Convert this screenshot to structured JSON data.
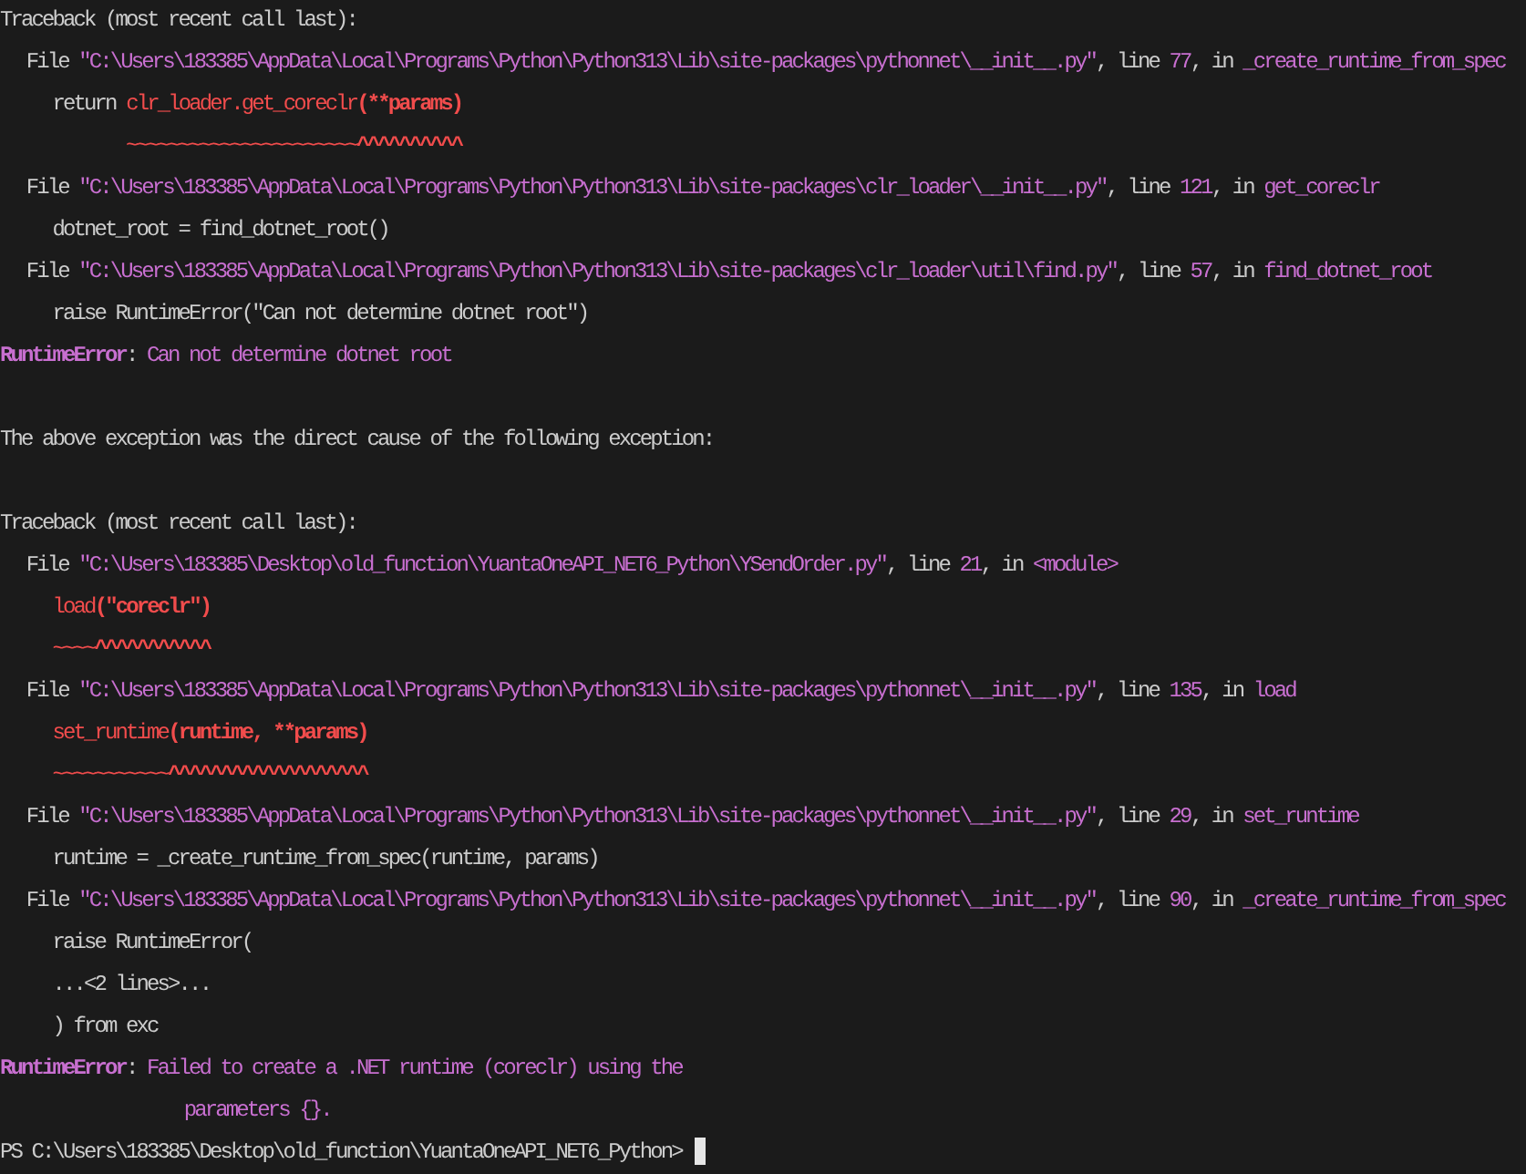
{
  "terminal": {
    "lines": [
      {
        "kind": "header",
        "segments": [
          {
            "kind": "plain",
            "text": "Traceback (most recent call last):"
          }
        ]
      },
      {
        "kind": "frame",
        "segments": [
          {
            "kind": "plain",
            "text": "File "
          },
          {
            "kind": "accent",
            "text": "\"C:\\Users\\183385\\AppData\\Local\\Programs\\Python\\Python313\\Lib\\site-packages\\pythonnet\\__init__.py\""
          },
          {
            "kind": "plain",
            "text": ", line "
          },
          {
            "kind": "accent",
            "text": "77"
          },
          {
            "kind": "plain",
            "text": ", in "
          },
          {
            "kind": "accent",
            "text": "_create_runtime_from_spec"
          }
        ]
      },
      {
        "kind": "source",
        "segments": [
          {
            "kind": "plain",
            "text": "return "
          },
          {
            "kind": "error",
            "text": "clr_loader.get_coreclr"
          },
          {
            "kind": "error-strong",
            "text": "(**params)"
          }
        ]
      },
      {
        "kind": "source",
        "segments": [
          {
            "kind": "error",
            "text": "       ~~~~~~~~~~~~~~~~~~~~~~"
          },
          {
            "kind": "error-strong",
            "text": "^^^^^^^^^^"
          }
        ]
      },
      {
        "kind": "frame",
        "segments": [
          {
            "kind": "plain",
            "text": "File "
          },
          {
            "kind": "accent",
            "text": "\"C:\\Users\\183385\\AppData\\Local\\Programs\\Python\\Python313\\Lib\\site-packages\\clr_loader\\__init__.py\""
          },
          {
            "kind": "plain",
            "text": ", line "
          },
          {
            "kind": "accent",
            "text": "121"
          },
          {
            "kind": "plain",
            "text": ", in "
          },
          {
            "kind": "accent",
            "text": "get_coreclr"
          }
        ]
      },
      {
        "kind": "source",
        "segments": [
          {
            "kind": "plain",
            "text": "dotnet_root = find_dotnet_root()"
          }
        ]
      },
      {
        "kind": "frame",
        "segments": [
          {
            "kind": "plain",
            "text": "File "
          },
          {
            "kind": "accent",
            "text": "\"C:\\Users\\183385\\AppData\\Local\\Programs\\Python\\Python313\\Lib\\site-packages\\clr_loader\\util\\find.py\""
          },
          {
            "kind": "plain",
            "text": ", line "
          },
          {
            "kind": "accent",
            "text": "57"
          },
          {
            "kind": "plain",
            "text": ", in "
          },
          {
            "kind": "accent",
            "text": "find_dotnet_root"
          }
        ]
      },
      {
        "kind": "source",
        "segments": [
          {
            "kind": "plain",
            "text": "raise RuntimeError(\"Can not determine dotnet root\")"
          }
        ]
      },
      {
        "kind": "header",
        "segments": [
          {
            "kind": "accent-strong",
            "text": "RuntimeError"
          },
          {
            "kind": "plain",
            "text": ": "
          },
          {
            "kind": "accent",
            "text": "Can not determine dotnet root"
          }
        ]
      },
      {
        "kind": "blank"
      },
      {
        "kind": "header",
        "segments": [
          {
            "kind": "plain",
            "text": "The above exception was the direct cause of the following exception:"
          }
        ]
      },
      {
        "kind": "blank"
      },
      {
        "kind": "header",
        "segments": [
          {
            "kind": "plain",
            "text": "Traceback (most recent call last):"
          }
        ]
      },
      {
        "kind": "frame",
        "segments": [
          {
            "kind": "plain",
            "text": "File "
          },
          {
            "kind": "accent",
            "text": "\"C:\\Users\\183385\\Desktop\\old_function\\YuantaOneAPI_NET6_Python\\YSendOrder.py\""
          },
          {
            "kind": "plain",
            "text": ", line "
          },
          {
            "kind": "accent",
            "text": "21"
          },
          {
            "kind": "plain",
            "text": ", in "
          },
          {
            "kind": "accent",
            "text": "<module>"
          }
        ]
      },
      {
        "kind": "source",
        "segments": [
          {
            "kind": "error",
            "text": "load"
          },
          {
            "kind": "error-strong",
            "text": "(\"coreclr\")"
          }
        ]
      },
      {
        "kind": "source",
        "segments": [
          {
            "kind": "error",
            "text": "~~~~"
          },
          {
            "kind": "error-strong",
            "text": "^^^^^^^^^^^"
          }
        ]
      },
      {
        "kind": "frame",
        "segments": [
          {
            "kind": "plain",
            "text": "File "
          },
          {
            "kind": "accent",
            "text": "\"C:\\Users\\183385\\AppData\\Local\\Programs\\Python\\Python313\\Lib\\site-packages\\pythonnet\\__init__.py\""
          },
          {
            "kind": "plain",
            "text": ", line "
          },
          {
            "kind": "accent",
            "text": "135"
          },
          {
            "kind": "plain",
            "text": ", in "
          },
          {
            "kind": "accent",
            "text": "load"
          }
        ]
      },
      {
        "kind": "source",
        "segments": [
          {
            "kind": "error",
            "text": "set_runtime"
          },
          {
            "kind": "error-strong",
            "text": "(runtime, **params)"
          }
        ]
      },
      {
        "kind": "source",
        "segments": [
          {
            "kind": "error",
            "text": "~~~~~~~~~~~"
          },
          {
            "kind": "error-strong",
            "text": "^^^^^^^^^^^^^^^^^^^"
          }
        ]
      },
      {
        "kind": "frame",
        "segments": [
          {
            "kind": "plain",
            "text": "File "
          },
          {
            "kind": "accent",
            "text": "\"C:\\Users\\183385\\AppData\\Local\\Programs\\Python\\Python313\\Lib\\site-packages\\pythonnet\\__init__.py\""
          },
          {
            "kind": "plain",
            "text": ", line "
          },
          {
            "kind": "accent",
            "text": "29"
          },
          {
            "kind": "plain",
            "text": ", in "
          },
          {
            "kind": "accent",
            "text": "set_runtime"
          }
        ]
      },
      {
        "kind": "source",
        "segments": [
          {
            "kind": "plain",
            "text": "runtime = _create_runtime_from_spec(runtime, params)"
          }
        ]
      },
      {
        "kind": "frame",
        "segments": [
          {
            "kind": "plain",
            "text": "File "
          },
          {
            "kind": "accent",
            "text": "\"C:\\Users\\183385\\AppData\\Local\\Programs\\Python\\Python313\\Lib\\site-packages\\pythonnet\\__init__.py\""
          },
          {
            "kind": "plain",
            "text": ", line "
          },
          {
            "kind": "accent",
            "text": "90"
          },
          {
            "kind": "plain",
            "text": ", in "
          },
          {
            "kind": "accent",
            "text": "_create_runtime_from_spec"
          }
        ]
      },
      {
        "kind": "source",
        "segments": [
          {
            "kind": "plain",
            "text": "raise RuntimeError("
          }
        ]
      },
      {
        "kind": "source",
        "segments": [
          {
            "kind": "plain",
            "text": "...<2 lines>..."
          }
        ]
      },
      {
        "kind": "source",
        "segments": [
          {
            "kind": "plain",
            "text": ") from exc"
          }
        ]
      },
      {
        "kind": "header",
        "segments": [
          {
            "kind": "accent-strong",
            "text": "RuntimeError"
          },
          {
            "kind": "plain",
            "text": ": "
          },
          {
            "kind": "accent",
            "text": "Failed to create a .NET runtime (coreclr) using the"
          }
        ]
      },
      {
        "kind": "continuation",
        "segments": [
          {
            "kind": "accent",
            "text": "parameters {}."
          }
        ]
      },
      {
        "kind": "prompt",
        "segments": [
          {
            "kind": "plain",
            "text": "PS C:\\Users\\183385\\Desktop\\old_function\\YuantaOneAPI_NET6_Python> "
          }
        ],
        "cursor": true
      }
    ]
  }
}
